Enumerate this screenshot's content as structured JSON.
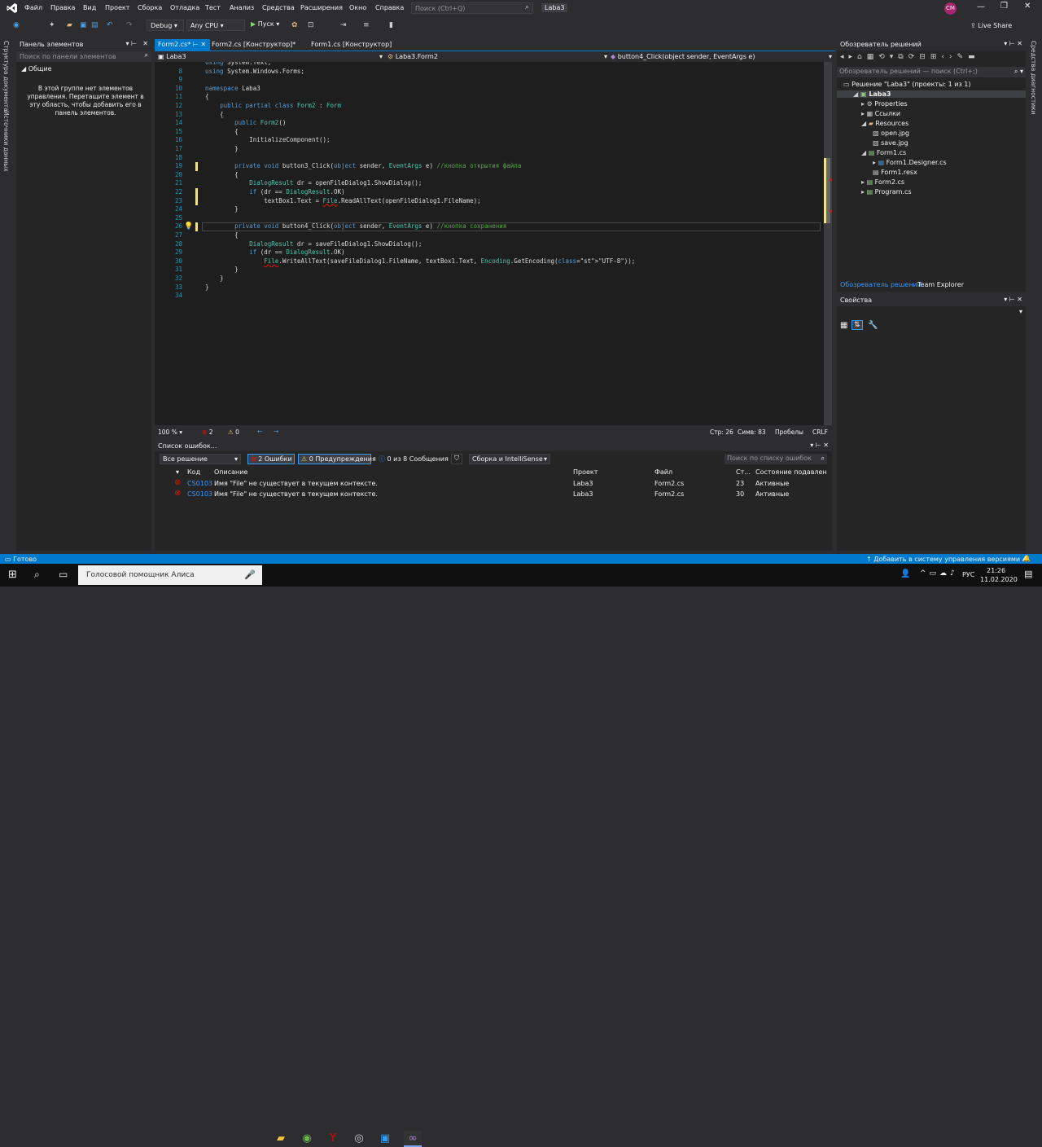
{
  "menu": [
    "Файл",
    "Правка",
    "Вид",
    "Проект",
    "Сборка",
    "Отладка",
    "Тест",
    "Анализ",
    "Средства",
    "Расширения",
    "Окно",
    "Справка"
  ],
  "search_placeholder": "Поиск (Ctrl+Q)",
  "solution_title": "Laba3",
  "user_initials": "CM",
  "live_share": "Live Share",
  "toolbar": {
    "config": "Debug",
    "platform": "Any CPU",
    "run": "Пуск"
  },
  "side_tabs": [
    "Структура документа",
    "Источники данных"
  ],
  "right_side_tab": "Средства диагностики",
  "toolbox": {
    "title": "Панель элементов",
    "search": "Поиск по панели элементов",
    "group": "Общие",
    "empty_msg": "В этой группе нет элементов управления. Перетащите элемент в эту область, чтобы добавить его в панель элементов."
  },
  "tabs": [
    "Form2.cs*",
    "Form2.cs [Конструктор]*",
    "Form1.cs [Конструктор]"
  ],
  "nav": {
    "project": "Laba3",
    "class": "Laba3.Form2",
    "member": "button4_Click(object sender, EventArgs e)"
  },
  "code_lines": [
    {
      "n": "",
      "t": "using System.Text;"
    },
    {
      "n": "8",
      "t": "using System.Windows.Forms;"
    },
    {
      "n": "9",
      "t": ""
    },
    {
      "n": "10",
      "t": "namespace Laba3"
    },
    {
      "n": "11",
      "t": "{"
    },
    {
      "n": "12",
      "t": "    public partial class Form2 : Form"
    },
    {
      "n": "13",
      "t": "    {"
    },
    {
      "n": "14",
      "t": "        public Form2()"
    },
    {
      "n": "15",
      "t": "        {"
    },
    {
      "n": "16",
      "t": "            InitializeComponent();"
    },
    {
      "n": "17",
      "t": "        }"
    },
    {
      "n": "18",
      "t": ""
    },
    {
      "n": "19",
      "t": "        private void button3_Click(object sender, EventArgs e) //кнопка открытия файла"
    },
    {
      "n": "20",
      "t": "        {"
    },
    {
      "n": "21",
      "t": "            DialogResult dr = openFileDialog1.ShowDialog();"
    },
    {
      "n": "22",
      "t": "            if (dr == DialogResult.OK)"
    },
    {
      "n": "23",
      "t": "                textBox1.Text = File.ReadAllText(openFileDialog1.FileName);"
    },
    {
      "n": "24",
      "t": "        }"
    },
    {
      "n": "25",
      "t": ""
    },
    {
      "n": "26",
      "t": "        private void button4_Click(object sender, EventArgs e) //кнопка сохранения"
    },
    {
      "n": "27",
      "t": "        {"
    },
    {
      "n": "28",
      "t": "            DialogResult dr = saveFileDialog1.ShowDialog();"
    },
    {
      "n": "29",
      "t": "            if (dr == DialogResult.OK)"
    },
    {
      "n": "30",
      "t": "                File.WriteAllText(saveFileDialog1.FileName, textBox1.Text, Encoding.GetEncoding(\"UTF-8\"));"
    },
    {
      "n": "31",
      "t": "        }"
    },
    {
      "n": "32",
      "t": "    }"
    },
    {
      "n": "33",
      "t": "}"
    },
    {
      "n": "34",
      "t": ""
    }
  ],
  "editor_status": {
    "zoom": "100 %",
    "errors": "2",
    "warnings": "0",
    "pos": "Стр: 26",
    "col": "Симв: 83",
    "ws": "Пробелы",
    "eol": "CRLF"
  },
  "error_list": {
    "title": "Список ошибок...",
    "scope": "Все решение",
    "errors_btn": "2 Ошибки",
    "warn_btn": "0 Предупреждения",
    "msg_btn": "0 из 8 Сообщения",
    "build": "Сборка и IntelliSense",
    "search": "Поиск по списку ошибок",
    "headers": [
      "Код",
      "Описание",
      "Проект",
      "Файл",
      "Ст...",
      "Состояние подавлен"
    ],
    "rows": [
      {
        "code": "CS0103",
        "desc": "Имя \"File\" не существует в текущем контексте.",
        "project": "Laba3",
        "file": "Form2.cs",
        "line": "23",
        "state": "Активные"
      },
      {
        "code": "CS0103",
        "desc": "Имя \"File\" не существует в текущем контексте.",
        "project": "Laba3",
        "file": "Form2.cs",
        "line": "30",
        "state": "Активные"
      }
    ]
  },
  "solution_explorer": {
    "title": "Обозреватель решений",
    "search": "Обозреватель решений — поиск (Ctrl+;)",
    "items": [
      "Решение \"Laba3\" (проекты: 1 из 1)",
      "Laba3",
      "Properties",
      "Ссылки",
      "Resources",
      "open.jpg",
      "save.jpg",
      "Form1.cs",
      "Form1.Designer.cs",
      "Form1.resx",
      "Form2.cs",
      "Program.cs"
    ],
    "tab1": "Обозреватель решений",
    "tab2": "Team Explorer"
  },
  "properties": {
    "title": "Свойства"
  },
  "statusbar": {
    "ready": "Готово",
    "vcs": "Добавить в систему управления версиями"
  },
  "taskbar": {
    "search": "Голосовой помощник Алиса",
    "time": "21:26",
    "date": "11.02.2020",
    "lang": "РУС"
  }
}
